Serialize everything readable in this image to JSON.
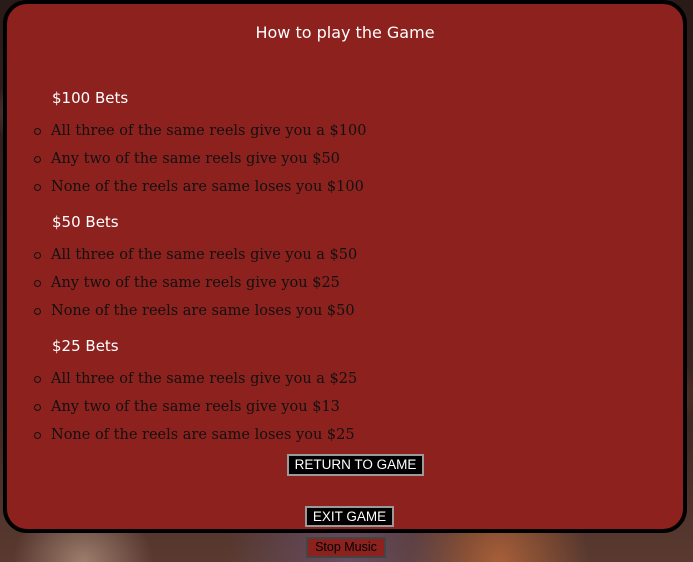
{
  "modal": {
    "title": "How to play the Game",
    "sections": [
      {
        "heading": "$100 Bets",
        "rules": [
          "All three of the same reels give you a $100",
          "Any two of the same reels give you $50",
          "None of the reels are same loses you $100"
        ]
      },
      {
        "heading": "$50 Bets",
        "rules": [
          "All three of the same reels give you a $50",
          "Any two of the same reels give you $25",
          "None of the reels are same loses you $50"
        ]
      },
      {
        "heading": "$25 Bets",
        "rules": [
          "All three of the same reels give you a $25",
          "Any two of the same reels give you $13",
          "None of the reels are same loses you $25"
        ]
      }
    ],
    "return_label": "RETURN TO GAME",
    "exit_label": "EXIT GAME"
  },
  "music_button_label": "Stop Music",
  "colors": {
    "modal_background": "#8d211e",
    "button_background": "#000000",
    "text_light": "#ffffff"
  }
}
